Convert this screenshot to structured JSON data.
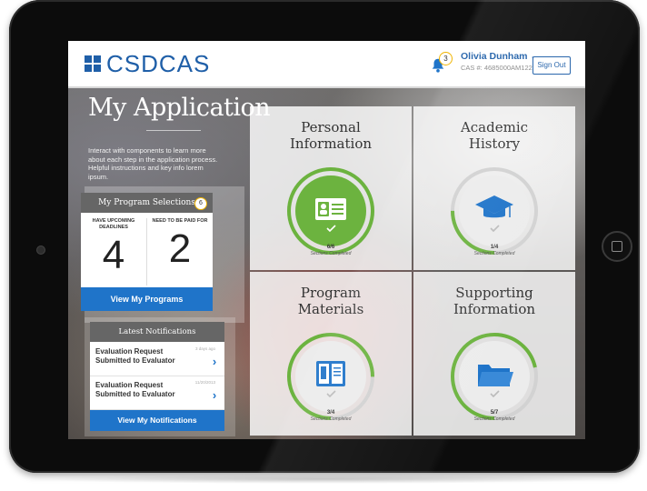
{
  "header": {
    "logo_text": "CSDCAS",
    "bell_count": "3",
    "user_name": "Olivia Dunham",
    "user_cas": "CAS #: 4685000AM122",
    "sign_out": "Sign Out"
  },
  "page": {
    "title": "My Application",
    "intro": "Interact with components to learn more about each step in the application process. Helpful instructions and key info lorem ipsum."
  },
  "programs": {
    "heading": "My Program Selections",
    "badge": "6",
    "stats": [
      {
        "label": "HAVE UPCOMING DEADLINES",
        "value": "4"
      },
      {
        "label": "NEED TO BE PAID FOR",
        "value": "2"
      }
    ],
    "button": "View My Programs"
  },
  "notifications": {
    "heading": "Latest Notifications",
    "items": [
      {
        "title": "Evaluation Request Submitted to Evaluator",
        "time": "3 days ago"
      },
      {
        "title": "Evaluation Request Submitted to Evaluator",
        "time": "11/20/2013"
      }
    ],
    "button": "View My Notifications"
  },
  "sections": [
    {
      "title_line1": "Personal",
      "title_line2": "Information",
      "count": "6/6",
      "subtitle": "Sections Completed",
      "icon": "id-card-icon",
      "progress": 1.0
    },
    {
      "title_line1": "Academic",
      "title_line2": "History",
      "count": "1/4",
      "subtitle": "Sections Completed",
      "icon": "graduation-cap-icon",
      "progress": 0.25
    },
    {
      "title_line1": "Program",
      "title_line2": "Materials",
      "count": "3/4",
      "subtitle": "Sections Completed",
      "icon": "book-icon",
      "progress": 0.75
    },
    {
      "title_line1": "Supporting",
      "title_line2": "Information",
      "count": "5/7",
      "subtitle": "Sections Completed",
      "icon": "folder-icon",
      "progress": 0.714
    }
  ],
  "colors": {
    "brand_blue": "#1f5fa8",
    "button_blue": "#1f74c9",
    "progress_green": "#6cb33f",
    "badge_gold": "#f0b400"
  }
}
